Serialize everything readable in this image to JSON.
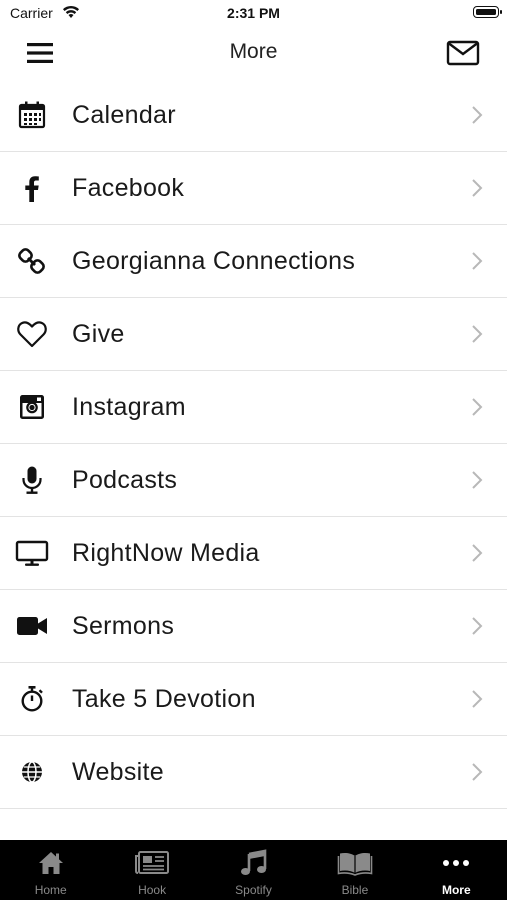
{
  "status_bar": {
    "carrier": "Carrier",
    "time": "2:31 PM"
  },
  "nav": {
    "title": "More",
    "menu_icon": "hamburger-menu-icon",
    "mail_icon": "envelope-icon"
  },
  "list": {
    "items": [
      {
        "label": "Calendar",
        "icon": "calendar-icon"
      },
      {
        "label": "Facebook",
        "icon": "facebook-icon"
      },
      {
        "label": "Georgianna Connections",
        "icon": "link-icon"
      },
      {
        "label": "Give",
        "icon": "heart-icon"
      },
      {
        "label": "Instagram",
        "icon": "instagram-icon"
      },
      {
        "label": "Podcasts",
        "icon": "microphone-icon"
      },
      {
        "label": "RightNow Media",
        "icon": "monitor-icon"
      },
      {
        "label": "Sermons",
        "icon": "video-camera-icon"
      },
      {
        "label": "Take 5 Devotion",
        "icon": "stopwatch-icon"
      },
      {
        "label": "Website",
        "icon": "globe-icon"
      }
    ]
  },
  "tabbar": {
    "active_color": "#ffffff",
    "inactive_color": "#8a8a8a",
    "background": "#000000",
    "tabs": [
      {
        "label": "Home",
        "icon": "house-icon"
      },
      {
        "label": "Hook",
        "icon": "newspaper-icon"
      },
      {
        "label": "Spotify",
        "icon": "music-note-icon"
      },
      {
        "label": "Bible",
        "icon": "open-book-icon"
      },
      {
        "label": "More",
        "icon": "more-dots-icon",
        "active": true
      }
    ]
  }
}
